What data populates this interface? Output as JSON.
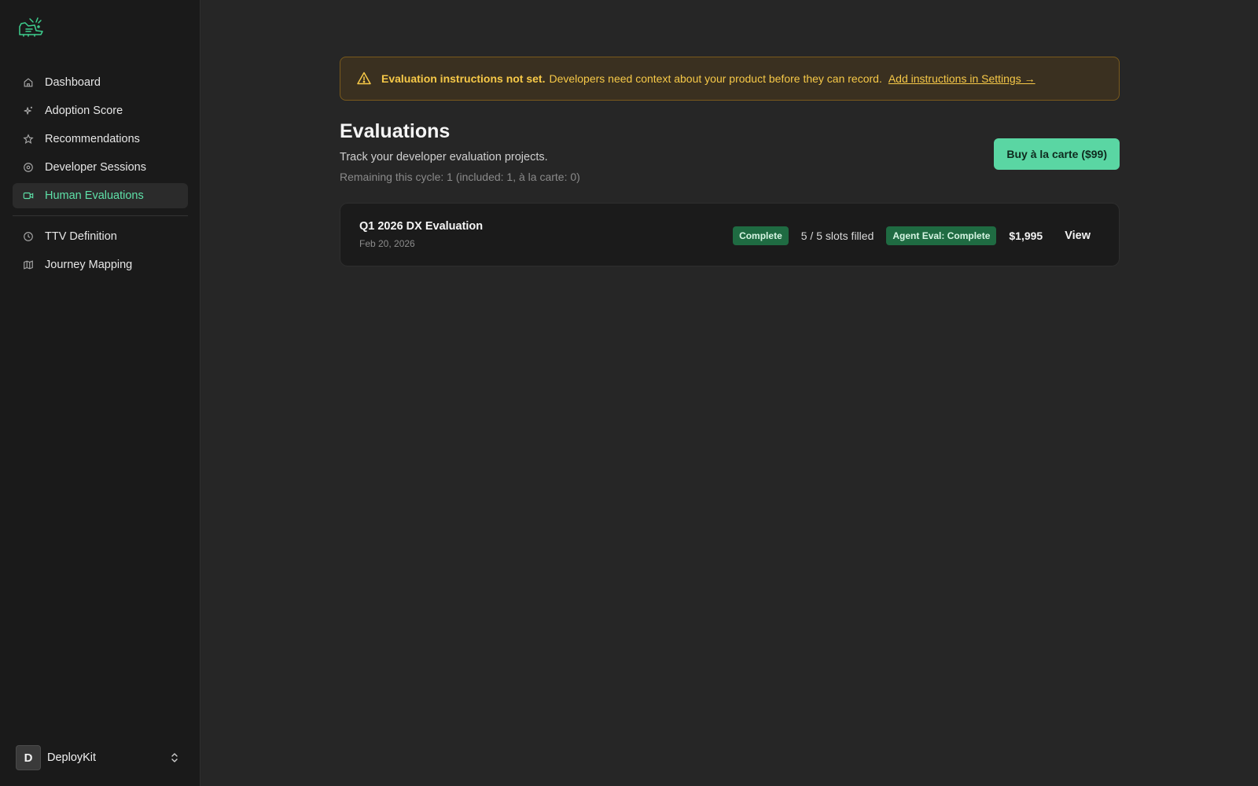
{
  "sidebar": {
    "logo_icon": "deploy-mascot-logo",
    "items": [
      {
        "label": "Dashboard",
        "icon": "home-icon"
      },
      {
        "label": "Adoption Score",
        "icon": "sparkle-icon"
      },
      {
        "label": "Recommendations",
        "icon": "star-icon"
      },
      {
        "label": "Developer Sessions",
        "icon": "target-icon"
      },
      {
        "label": "Human Evaluations",
        "icon": "video-icon",
        "active": true
      },
      {
        "label": "TTV Definition",
        "icon": "clock-icon"
      },
      {
        "label": "Journey Mapping",
        "icon": "map-icon"
      }
    ],
    "workspace": {
      "initial": "D",
      "name": "DeployKit"
    }
  },
  "alert": {
    "icon": "warning-icon",
    "title": "Evaluation instructions not set.",
    "message": "Developers need context about your product before they can record.",
    "link": "Add instructions in Settings →",
    "color": "#f7c948"
  },
  "page": {
    "title": "Evaluations",
    "subtitle": "Track your developer evaluation projects.",
    "remaining": "Remaining this cycle: 1 (included: 1, à la carte: 0)",
    "buy_button": "Buy à la carte ($99)"
  },
  "evaluations": [
    {
      "name": "Q1 2026 DX Evaluation",
      "date": "Feb 20, 2026",
      "status": "Complete",
      "slots": "5 / 5 slots filled",
      "agent_eval": "Agent Eval: Complete",
      "price": "$1,995",
      "action": "View"
    }
  ],
  "colors": {
    "accent": "#5ad6a3",
    "active_nav": "#5ee0a8",
    "badge_bg": "#1f6b42",
    "warning": "#f7c948"
  }
}
